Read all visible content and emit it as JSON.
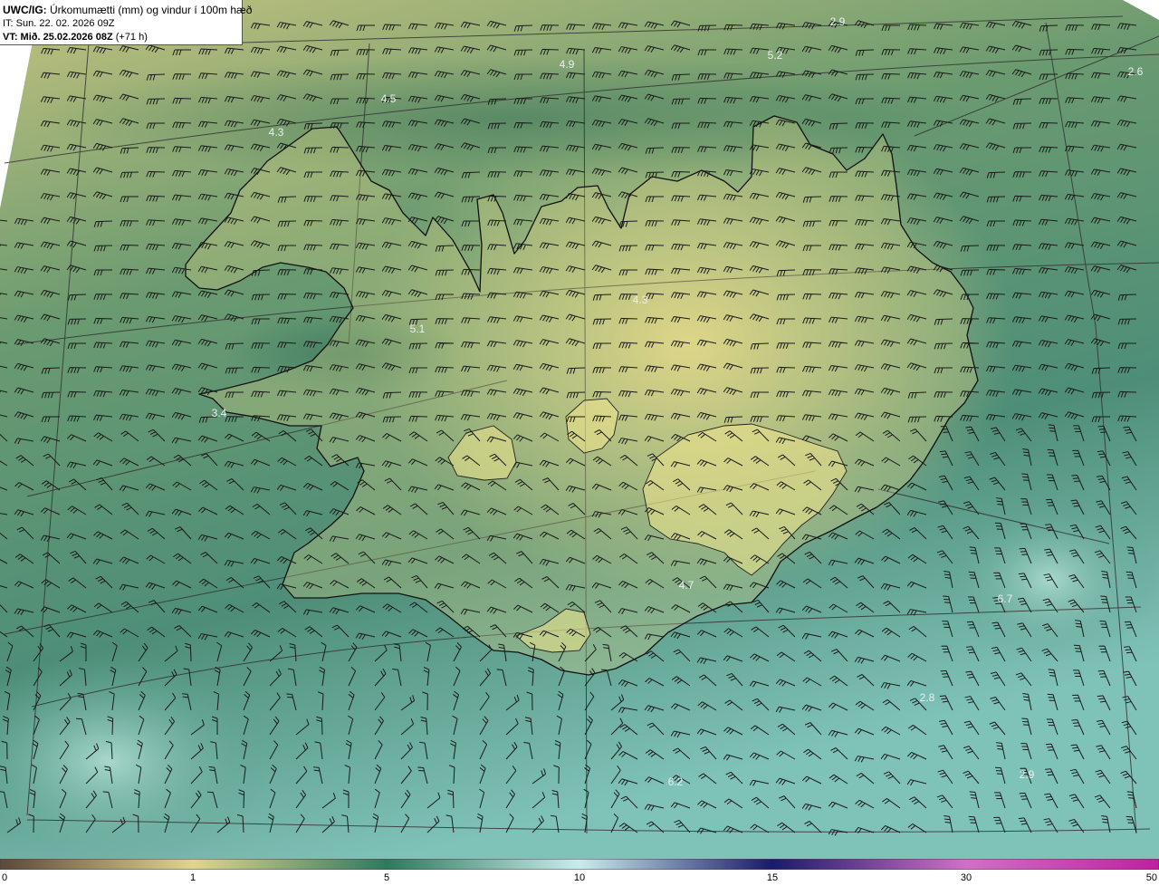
{
  "header": {
    "title_bold": "UWC/IG:",
    "title_rest": " Úrkomumætti (mm) og vindur í 100m hæð",
    "issue_time": "IT: Sun. 22. 02. 2026 09Z",
    "valid_prefix": "VT: Mið. 25.02.2026 08Z",
    "valid_suffix": " (+71 h)"
  },
  "map_labels": [
    {
      "text": "2.9"
    },
    {
      "text": "5.2"
    },
    {
      "text": "4.9"
    },
    {
      "text": "2.6"
    },
    {
      "text": "4.5"
    },
    {
      "text": "4.3"
    },
    {
      "text": "4.3"
    },
    {
      "text": "5.1"
    },
    {
      "text": "3.4"
    },
    {
      "text": "4.7"
    },
    {
      "text": "6.7"
    },
    {
      "text": "2.8"
    },
    {
      "text": "6.2"
    },
    {
      "text": "2.9"
    }
  ],
  "colorbar": {
    "ticks": [
      "0",
      "1",
      "5",
      "10",
      "15",
      "30",
      "50"
    ],
    "colors": [
      "#5c4a3a",
      "#e0d490",
      "#2e7a5e",
      "#c8ecec",
      "#1a1a6a",
      "#d070c8",
      "#c020a0"
    ]
  }
}
